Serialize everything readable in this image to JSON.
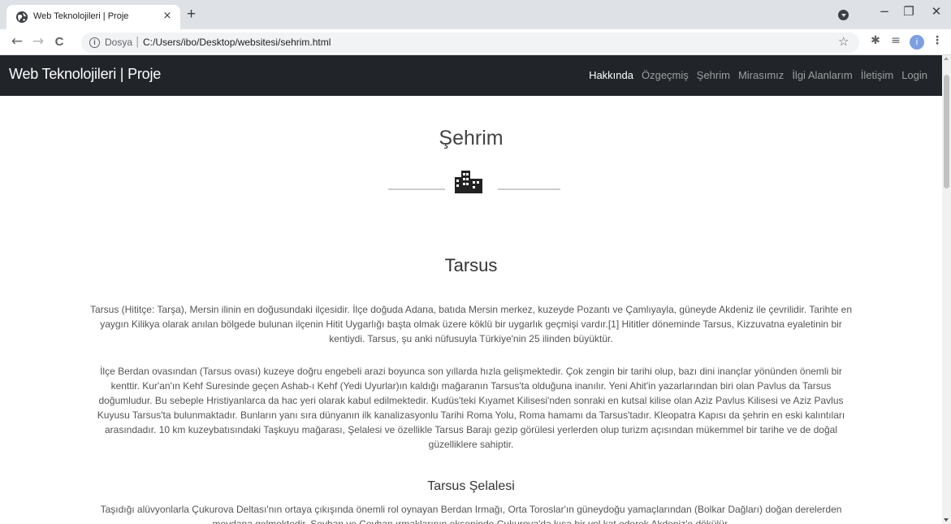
{
  "browser": {
    "tab_title": "Web Teknolojileri | Proje",
    "tab_close": "×",
    "new_tab": "+",
    "omnibox_scheme": "Dosya",
    "omnibox_separator": "|",
    "omnibox_url": "C:/Users/ibo/Desktop/websitesi/sehrim.html",
    "info_icon": "i",
    "avatar_initial": "i",
    "window_controls": [
      "−",
      "❐",
      "✕"
    ],
    "nav": [
      "←",
      "→",
      "C"
    ]
  },
  "navbar": {
    "brand": "Web Teknolojileri | Proje",
    "items": [
      {
        "label": "Hakkında",
        "active": true
      },
      {
        "label": "Özgeçmiş",
        "active": false
      },
      {
        "label": "Şehrim",
        "active": false
      },
      {
        "label": "Mirasımız",
        "active": false
      },
      {
        "label": "İlgi Alanlarım",
        "active": false
      },
      {
        "label": "İletişim",
        "active": false
      },
      {
        "label": "Login",
        "active": false
      }
    ]
  },
  "page": {
    "title": "Şehrim",
    "section_title": "Tarsus",
    "paragraph_1": "Tarsus (Hititçe: Tarşa), Mersin ilinin en doğusundaki ilçesidir. İlçe doğuda Adana, batıda Mersin merkez, kuzeyde Pozantı ve Çamlıyayla, güneyde Akdeniz ile çevrilidir. Tarihte en yaygın Kilikya olarak anılan bölgede bulunan ilçenin Hitit Uygarlığı başta olmak üzere köklü bir uygarlık geçmişi vardır.[1] Hititler döneminde Tarsus, Kizzuvatna eyaletinin bir kentiydi. Tarsus, şu anki nüfusuyla Türkiye'nin 25 ilinden büyüktür.",
    "paragraph_2": "İlçe Berdan ovasından (Tarsus ovası) kuzeye doğru engebeli arazi boyunca son yıllarda hızla gelişmektedir. Çok zengin bir tarihi olup, bazı dini inançlar yönünden önemli bir kenttir. Kur'an'ın Kehf Suresinde geçen Ashab-ı Kehf (Yedi Uyurlar)ın kaldığı mağaranın Tarsus'ta olduğuna inanılır. Yeni Ahit'in yazarlarından biri olan Pavlus da Tarsus doğumludur. Bu sebeple Hristiyanlarca da hac yeri olarak kabul edilmektedir. Kudüs'teki Kıyamet Kilisesi'nden sonraki en kutsal kilise olan Aziz Pavlus Kilisesi ve Aziz Pavlus Kuyusu Tarsus'ta bulunmaktadır. Bunların yanı sıra dünyanın ilk kanalizasyonlu Tarihi Roma Yolu, Roma hamamı da Tarsus'tadır. Kleopatra Kapısı da şehrin en eski kalıntıları arasındadır. 10 km kuzeybatısındaki Taşkuyu mağarası, Şelalesi ve özellikle Tarsus Barajı gezip görülesi yerlerden olup turizm açısından mükemmel bir tarihe ve de doğal güzelliklere sahiptir.",
    "subsection_title": "Tarsus Şelalesi",
    "paragraph_3": "Taşıdığı alüvyonlarla Çukurova Deltası'nın ortaya çıkışında önemli rol oynayan Berdan Irmağı, Orta Toroslar'ın güneydoğu yamaçlarından (Bolkar Dağları) doğan derelerden meydana gelmektedir. Seyhan ve Ceyhan ırmaklarının ekseninde Çukurova'da kısa bir yol kat ederek Akdeniz'e dökülür."
  }
}
